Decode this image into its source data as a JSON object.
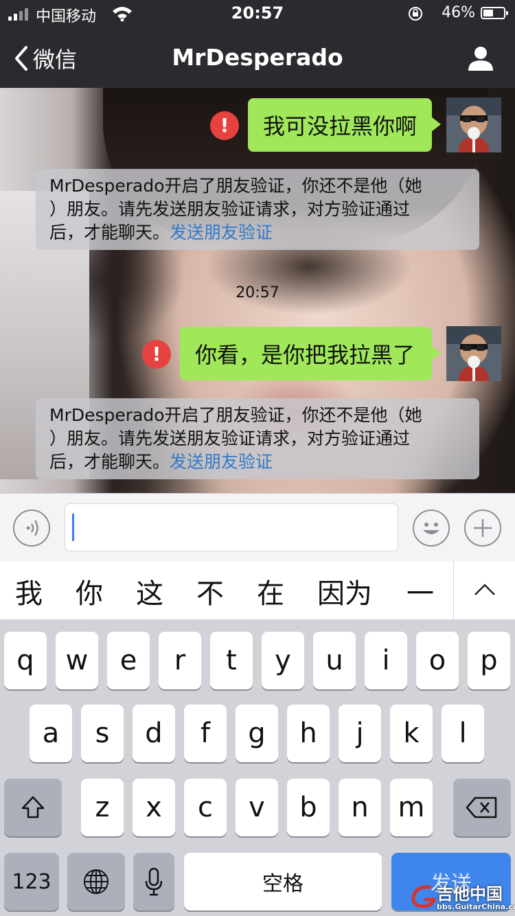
{
  "status_bar": {
    "carrier": "中国移动",
    "time": "20:57",
    "battery": "46%",
    "battery_level": 0.46
  },
  "nav": {
    "back_label": "微信",
    "title": "MrDesperado"
  },
  "messages": {
    "msg1": "我可没拉黑你啊",
    "msg2": "你看，是你把我拉黑了",
    "error_mark": "!",
    "time_label": "20:57",
    "system_line1": "MrDesperado开启了朋友验证，你还不是他（她",
    "system_line2": "）朋友。请先发送朋友验证请求，对方验证通过",
    "system_line3_prefix": "后，才能聊天。",
    "system_link": "发送朋友验证"
  },
  "candidates": [
    "我",
    "你",
    "这",
    "不",
    "在",
    "因为",
    "一"
  ],
  "keyboard": {
    "row1": [
      "q",
      "w",
      "e",
      "r",
      "t",
      "y",
      "u",
      "i",
      "o",
      "p"
    ],
    "row2": [
      "a",
      "s",
      "d",
      "f",
      "g",
      "h",
      "j",
      "k",
      "l"
    ],
    "row3": [
      "z",
      "x",
      "c",
      "v",
      "b",
      "n",
      "m"
    ],
    "numbers_label": "123",
    "space_label": "空格",
    "send_label": "发送"
  },
  "watermark": {
    "brand": "吉他中国",
    "url": "bbs.GuitarChina.com"
  },
  "colors": {
    "bubble": "#a0e75a",
    "error": "#e64340",
    "link": "#2f7ac9",
    "send_key": "#3f86ec"
  }
}
